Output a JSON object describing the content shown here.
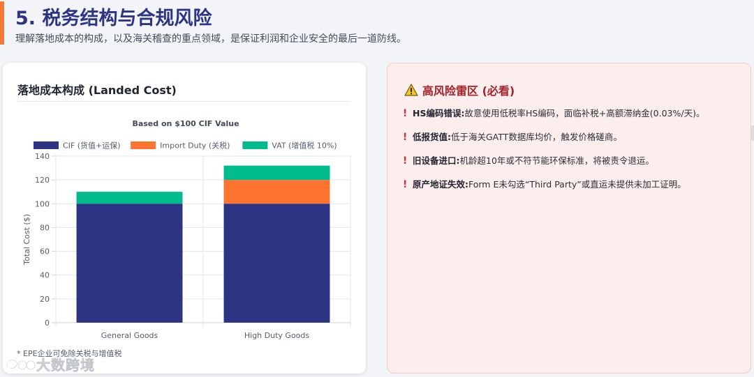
{
  "header": {
    "title": "5. 税务结构与合规风险",
    "subtitle": "理解落地成本的构成，以及海关稽查的重点领域，是保证利润和企业安全的最后一道防线。"
  },
  "left_card": {
    "title": "落地成本构成 (Landed Cost)",
    "footnote": "* EPE企业可免除关税与增值税"
  },
  "chart_data": {
    "type": "bar",
    "stacked": true,
    "title": "Based on $100 CIF Value",
    "ylabel": "Total Cost ($)",
    "xlabel": "",
    "ylim": [
      0,
      140
    ],
    "yticks": [
      0,
      20,
      40,
      60,
      80,
      100,
      120,
      140
    ],
    "grid": true,
    "legend_position": "top",
    "categories": [
      "General Goods",
      "High Duty Goods"
    ],
    "series": [
      {
        "name": "CIF (货值+运保)",
        "color": "#2e3484",
        "values": [
          100,
          100
        ]
      },
      {
        "name": "Import Duty (关税)",
        "color": "#ff7330",
        "values": [
          0,
          20
        ]
      },
      {
        "name": "VAT (增值税 10%)",
        "color": "#00bc8c",
        "values": [
          10,
          12
        ]
      }
    ]
  },
  "right_card": {
    "title": "高风险雷区 (必看)",
    "warning_icon": "warning-triangle-icon",
    "bang_symbol": "!",
    "items": [
      {
        "label": "HS编码错误:",
        "text": " 故意使用低税率HS编码，面临补税+高额滞纳金(0.03%/天)。"
      },
      {
        "label": "低报货值:",
        "text": " 低于海关GATT数据库均价，触发价格磋商。"
      },
      {
        "label": "旧设备进口:",
        "text": " 机龄超10年或不符节能环保标准，将被责令退运。"
      },
      {
        "label": "原产地证失效:",
        "text": " Form E未勾选“Third Party”或直运未提供未加工证明。"
      }
    ]
  },
  "watermark": {
    "text": "大数跨境"
  },
  "colors": {
    "accent": "#f37b3a",
    "title": "#2e3484",
    "danger": "#a6212a",
    "danger_bg": "#fdeeee"
  }
}
